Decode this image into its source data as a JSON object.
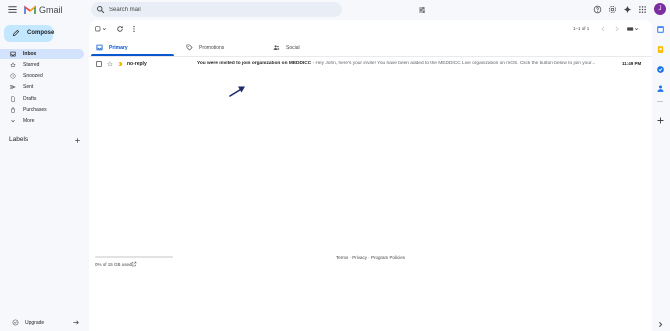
{
  "app": {
    "logo_text": "Gmail"
  },
  "search": {
    "placeholder": "Search mail"
  },
  "account": {
    "avatar_initial": "J"
  },
  "compose": {
    "label": "Compose"
  },
  "sidebar": {
    "items": [
      {
        "label": "Inbox",
        "icon": "inbox-icon",
        "active": true
      },
      {
        "label": "Starred",
        "icon": "star-icon"
      },
      {
        "label": "Snoozed",
        "icon": "clock-icon"
      },
      {
        "label": "Sent",
        "icon": "send-icon"
      },
      {
        "label": "Drafts",
        "icon": "draft-icon"
      },
      {
        "label": "Purchases",
        "icon": "purchases-icon"
      },
      {
        "label": "More",
        "icon": "chevron-down-icon"
      }
    ],
    "labels_heading": "Labels",
    "upgrade_label": "Upgrade"
  },
  "toolbar": {
    "pager_text": "1–1 of 1"
  },
  "tabs": [
    {
      "label": "Primary",
      "icon": "inbox-icon",
      "active": true
    },
    {
      "label": "Promotions",
      "icon": "tag-icon"
    },
    {
      "label": "Social",
      "icon": "people-icon"
    }
  ],
  "emails": [
    {
      "sender": "no-reply",
      "subject": "You were invited to join organization on MEDDICC",
      "snippet": " - Hey John, here's your invite! You have been added to the MEDDICC Live organization on mOS. Click the button below to join your...",
      "time": "11:49 PM",
      "unread": true
    }
  ],
  "storage": {
    "text": "0% of 15 GB used"
  },
  "footer": {
    "links": "Terms · Privacy · Program Policies"
  },
  "colors": {
    "accent": "#0b57d0",
    "compose_bg": "#c2e7ff",
    "active_nav": "#d3e3fd",
    "avatar": "#7b2ea0",
    "background": "#f6f8fc"
  }
}
